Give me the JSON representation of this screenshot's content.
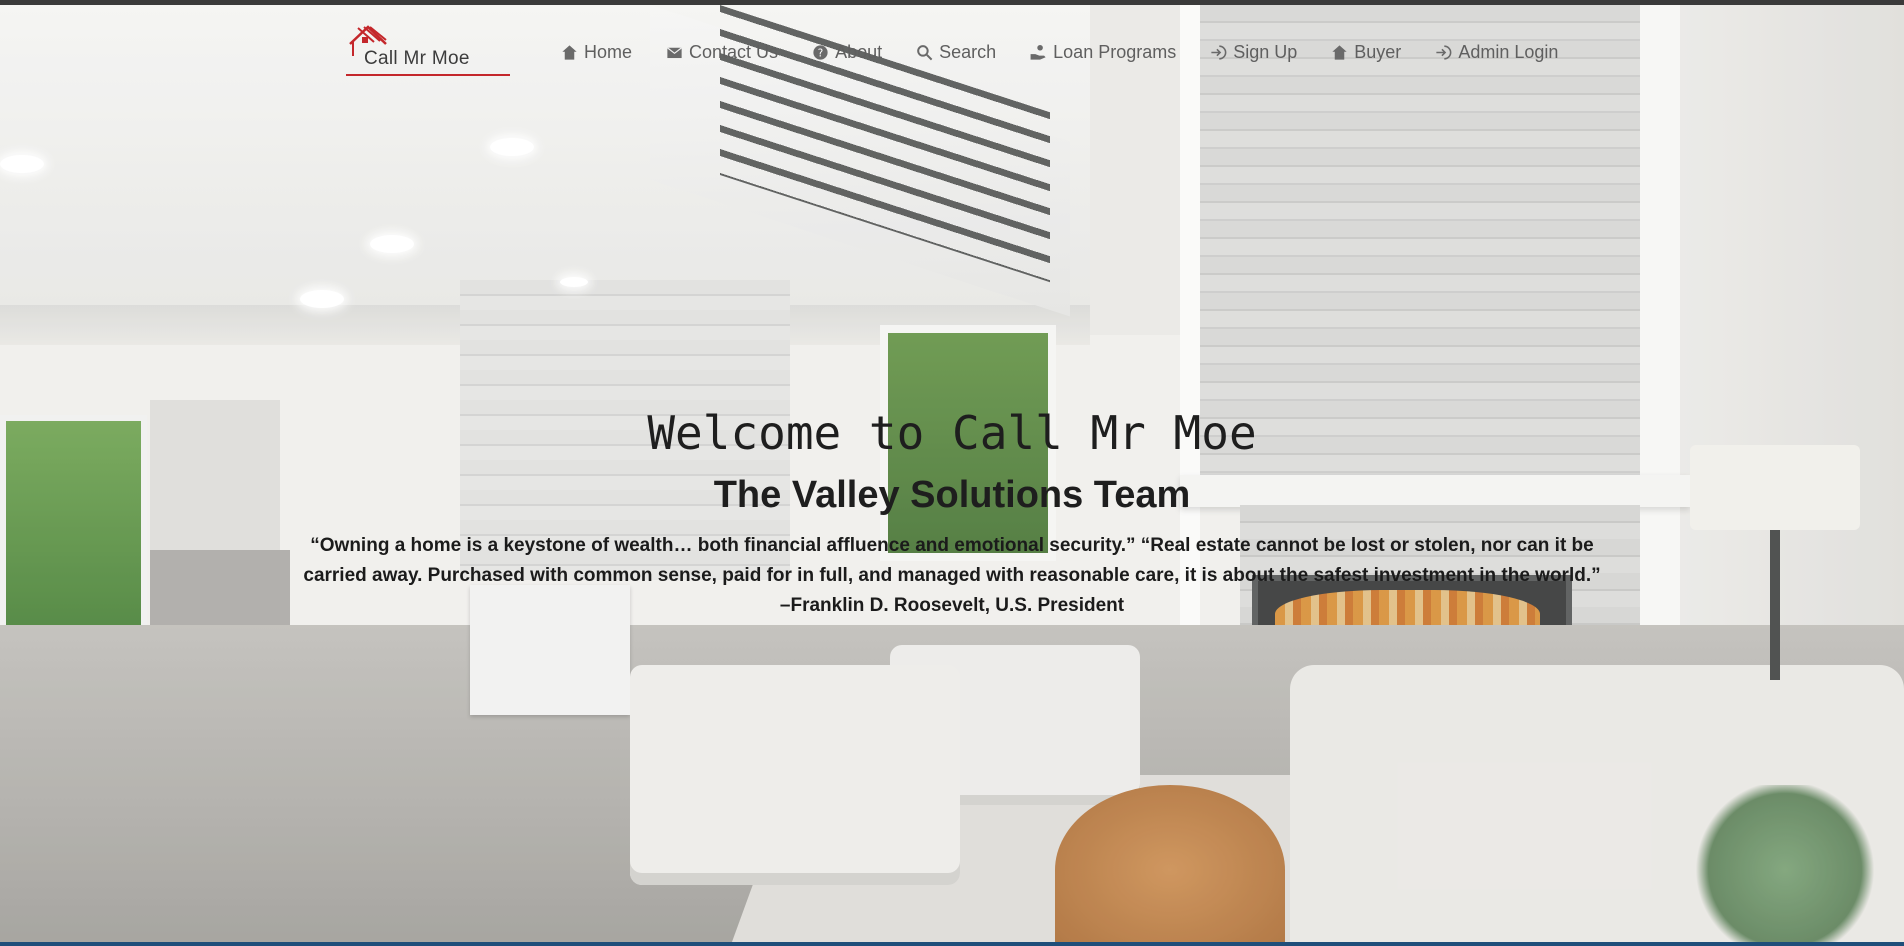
{
  "brand": {
    "logo_text": "Call Mr Moe",
    "accent_color": "#c4272b"
  },
  "nav": {
    "items": [
      {
        "label": "Home",
        "icon": "home-icon"
      },
      {
        "label": "Contact Us",
        "icon": "mail-icon"
      },
      {
        "label": "About",
        "icon": "help-icon"
      },
      {
        "label": "Search",
        "icon": "search-icon"
      },
      {
        "label": "Loan Programs",
        "icon": "hand-coin-icon"
      },
      {
        "label": "Sign Up",
        "icon": "login-icon"
      },
      {
        "label": "Buyer",
        "icon": "home-icon"
      },
      {
        "label": "Admin Login",
        "icon": "login-icon"
      }
    ]
  },
  "hero": {
    "title": "Welcome to Call Mr Moe",
    "subtitle": "The Valley Solutions Team",
    "quote": "“Owning a home is a keystone of wealth… both financial affluence and emotional security.” “Real estate cannot be lost or stolen, nor can it be carried away. Purchased with common sense, paid for in full, and managed with reasonable care, it is about the safest investment in the world.” –Franklin D. Roosevelt, U.S. President"
  }
}
